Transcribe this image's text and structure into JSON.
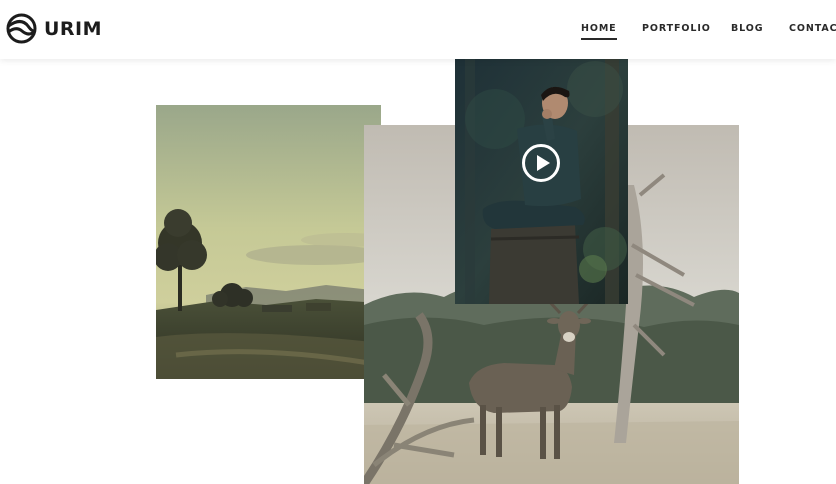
{
  "brand": {
    "name": "URIM",
    "icon": "urim-logo-icon"
  },
  "nav": {
    "items": [
      {
        "label": "HOME",
        "active": true
      },
      {
        "label": "PORTFOLIO",
        "active": false
      },
      {
        "label": "BLOG",
        "active": false
      },
      {
        "label": "CONTACT",
        "active": false
      }
    ]
  },
  "gallery": {
    "images": [
      {
        "subject": "landscape-tree-photo"
      },
      {
        "subject": "deer-photo"
      },
      {
        "subject": "man-sitting-photo",
        "has_video": true,
        "overlay_icon": "play-icon"
      }
    ]
  },
  "colors": {
    "text": "#1c1c1c",
    "background": "#ffffff"
  }
}
